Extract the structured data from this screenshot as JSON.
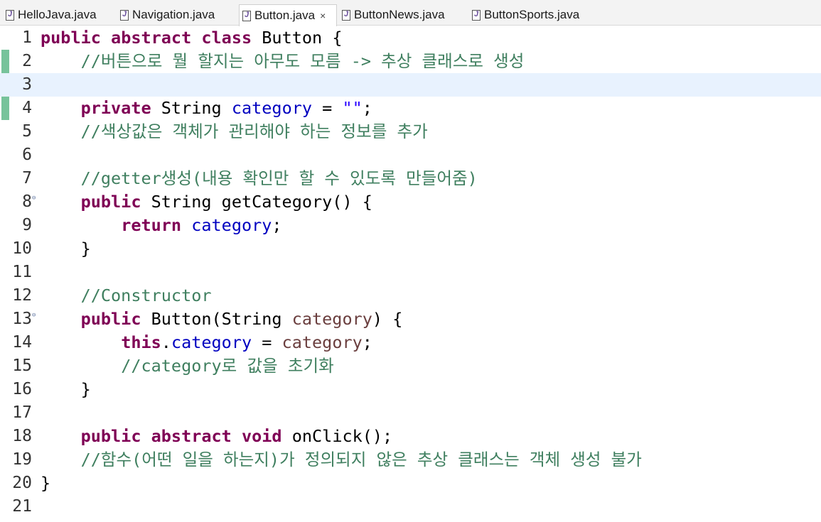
{
  "tabs": [
    {
      "label": "HelloJava.java",
      "active": false
    },
    {
      "label": "Navigation.java",
      "active": false
    },
    {
      "label": "Button.java",
      "active": true,
      "close": "×"
    },
    {
      "label": "ButtonNews.java",
      "active": false
    },
    {
      "label": "ButtonSports.java",
      "active": false
    }
  ],
  "editor": {
    "current_line": 3,
    "lines": [
      {
        "n": "1",
        "tokens": [
          [
            "kw",
            "public"
          ],
          [
            "",
            " "
          ],
          [
            "kw",
            "abstract"
          ],
          [
            "",
            " "
          ],
          [
            "kw",
            "class"
          ],
          [
            "",
            " Button {"
          ]
        ]
      },
      {
        "n": "2",
        "tokens": [
          [
            "",
            "    "
          ],
          [
            "cm",
            "//버튼으로 뭘 할지는 아무도 모름 -> 추상 클래스로 생성"
          ]
        ]
      },
      {
        "n": "3",
        "tokens": [
          [
            "",
            " "
          ]
        ]
      },
      {
        "n": "4",
        "tokens": [
          [
            "",
            "    "
          ],
          [
            "kw",
            "private"
          ],
          [
            "",
            " String "
          ],
          [
            "fld",
            "category"
          ],
          [
            "",
            " = "
          ],
          [
            "str",
            "\"\""
          ],
          [
            "",
            ";"
          ]
        ]
      },
      {
        "n": "5",
        "tokens": [
          [
            "",
            "    "
          ],
          [
            "cm",
            "//색상값은 객체가 관리해야 하는 정보를 추가"
          ]
        ]
      },
      {
        "n": "6",
        "tokens": [
          [
            "",
            " "
          ]
        ]
      },
      {
        "n": "7",
        "tokens": [
          [
            "",
            "    "
          ],
          [
            "cm",
            "//getter생성(내용 확인만 할 수 있도록 만들어줌)"
          ]
        ]
      },
      {
        "n": "8",
        "fold": true,
        "tokens": [
          [
            "",
            "    "
          ],
          [
            "kw",
            "public"
          ],
          [
            "",
            " String getCategory() {"
          ]
        ]
      },
      {
        "n": "9",
        "tokens": [
          [
            "",
            "        "
          ],
          [
            "kw",
            "return"
          ],
          [
            "",
            " "
          ],
          [
            "fld",
            "category"
          ],
          [
            "",
            ";"
          ]
        ]
      },
      {
        "n": "10",
        "tokens": [
          [
            "",
            "    }"
          ]
        ]
      },
      {
        "n": "11",
        "tokens": [
          [
            "",
            " "
          ]
        ]
      },
      {
        "n": "12",
        "tokens": [
          [
            "",
            "    "
          ],
          [
            "cm",
            "//Constructor"
          ]
        ]
      },
      {
        "n": "13",
        "fold": true,
        "tokens": [
          [
            "",
            "    "
          ],
          [
            "kw",
            "public"
          ],
          [
            "",
            " Button(String "
          ],
          [
            "par",
            "category"
          ],
          [
            "",
            ") {"
          ]
        ]
      },
      {
        "n": "14",
        "tokens": [
          [
            "",
            "        "
          ],
          [
            "kw",
            "this"
          ],
          [
            "",
            "."
          ],
          [
            "fld",
            "category"
          ],
          [
            "",
            " = "
          ],
          [
            "par",
            "category"
          ],
          [
            "",
            ";"
          ]
        ]
      },
      {
        "n": "15",
        "tokens": [
          [
            "",
            "        "
          ],
          [
            "cm",
            "//category로 값을 초기화"
          ]
        ]
      },
      {
        "n": "16",
        "tokens": [
          [
            "",
            "    }"
          ]
        ]
      },
      {
        "n": "17",
        "tokens": [
          [
            "",
            " "
          ]
        ]
      },
      {
        "n": "18",
        "tokens": [
          [
            "",
            "    "
          ],
          [
            "kw",
            "public"
          ],
          [
            "",
            " "
          ],
          [
            "kw",
            "abstract"
          ],
          [
            "",
            " "
          ],
          [
            "kw",
            "void"
          ],
          [
            "",
            " onClick();"
          ]
        ]
      },
      {
        "n": "19",
        "tokens": [
          [
            "",
            "    "
          ],
          [
            "cm",
            "//함수(어떤 일을 하는지)가 정의되지 않은 추상 클래스는 객체 생성 불가"
          ]
        ]
      },
      {
        "n": "20",
        "tokens": [
          [
            "",
            "}"
          ]
        ]
      },
      {
        "n": "21",
        "tokens": [
          [
            "",
            " "
          ]
        ]
      }
    ]
  }
}
